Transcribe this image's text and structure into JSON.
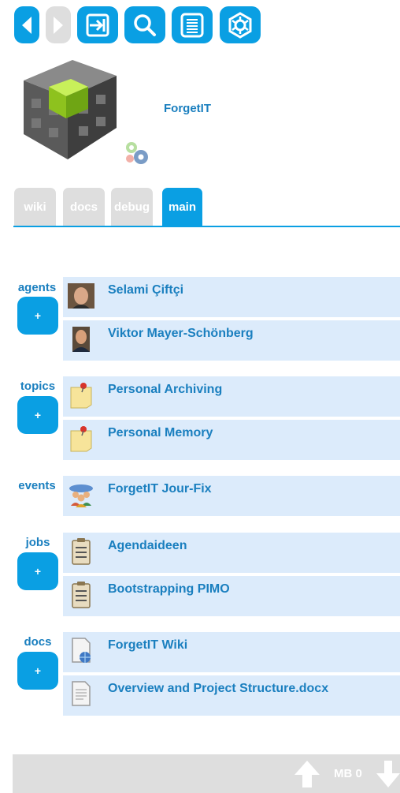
{
  "toolbar": {
    "buttons": [
      {
        "name": "back-button",
        "icon": "arrow-left-icon",
        "enabled": true
      },
      {
        "name": "forward-button",
        "icon": "arrow-right-icon",
        "enabled": false
      },
      {
        "name": "login-button",
        "icon": "login-icon",
        "enabled": true
      },
      {
        "name": "search-button",
        "icon": "search-icon",
        "enabled": true
      },
      {
        "name": "list-button",
        "icon": "list-icon",
        "enabled": true
      },
      {
        "name": "settings-button",
        "icon": "gear-icon",
        "enabled": true
      }
    ]
  },
  "header": {
    "title": "ForgetIT",
    "logo_icon": "cube-logo-icon",
    "status_icon": "gears-icon"
  },
  "tabs": [
    {
      "label": "wiki",
      "active": false
    },
    {
      "label": "docs",
      "active": false
    },
    {
      "label": "debug",
      "active": false
    },
    {
      "label": "main",
      "active": true
    }
  ],
  "sections": [
    {
      "label": "agents",
      "add_label": "+",
      "items": [
        {
          "label": "Selami Çiftçi",
          "icon": "person-photo-icon"
        },
        {
          "label": "Viktor Mayer-Schönberg",
          "icon": "person-photo-icon"
        }
      ]
    },
    {
      "label": "topics",
      "add_label": "+",
      "items": [
        {
          "label": "Personal Archiving",
          "icon": "sticky-note-icon"
        },
        {
          "label": "Personal Memory",
          "icon": "sticky-note-icon"
        }
      ]
    },
    {
      "label": "events",
      "items": [
        {
          "label": "ForgetIT Jour-Fix",
          "icon": "meeting-icon"
        }
      ]
    },
    {
      "label": "jobs",
      "add_label": "+",
      "items": [
        {
          "label": "Agendaideen",
          "icon": "clipboard-icon"
        },
        {
          "label": "Bootstrapping PIMO",
          "icon": "clipboard-icon"
        }
      ]
    },
    {
      "label": "docs",
      "add_label": "+",
      "items": [
        {
          "label": "ForgetIT Wiki",
          "icon": "web-document-icon"
        },
        {
          "label": "Overview and Project Structure.docx",
          "icon": "document-icon"
        }
      ]
    }
  ],
  "footer": {
    "mb_label": "MB 0",
    "up_icon": "arrow-up-icon",
    "down_icon": "arrow-down-icon"
  }
}
